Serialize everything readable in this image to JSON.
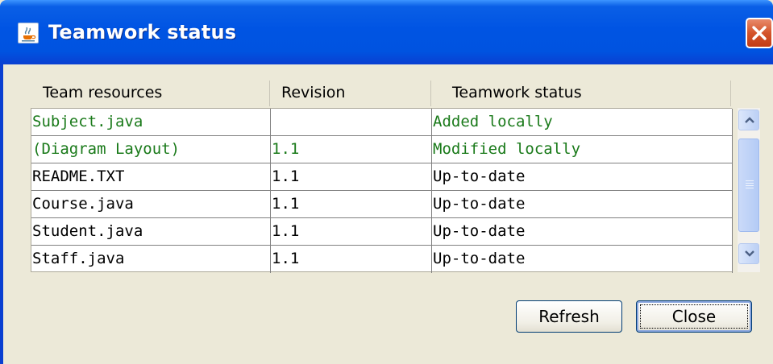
{
  "window": {
    "title": "Teamwork status"
  },
  "table": {
    "columns": [
      "Team resources",
      "Revision",
      "Teamwork status"
    ],
    "rows": [
      {
        "resource": "Subject.java",
        "revision": "",
        "status": "Added locally",
        "color": "#1a7a1a"
      },
      {
        "resource": "(Diagram Layout)",
        "revision": "1.1",
        "status": "Modified locally",
        "color": "#1a7a1a"
      },
      {
        "resource": "README.TXT",
        "revision": "1.1",
        "status": "Up-to-date",
        "color": "#000000"
      },
      {
        "resource": "Course.java",
        "revision": "1.1",
        "status": "Up-to-date",
        "color": "#000000"
      },
      {
        "resource": "Student.java",
        "revision": "1.1",
        "status": "Up-to-date",
        "color": "#000000"
      },
      {
        "resource": "Staff.java",
        "revision": "1.1",
        "status": "Up-to-date",
        "color": "#000000"
      }
    ]
  },
  "buttons": {
    "refresh": "Refresh",
    "close": "Close"
  },
  "icons": {
    "app": "java-cup-icon",
    "close": "close-x-icon",
    "scroll_up": "chevron-up-icon",
    "scroll_down": "chevron-down-icon"
  },
  "colors": {
    "titlebar": "#0054e3",
    "modified": "#1a7a1a",
    "dialog": "#ece9d8"
  }
}
